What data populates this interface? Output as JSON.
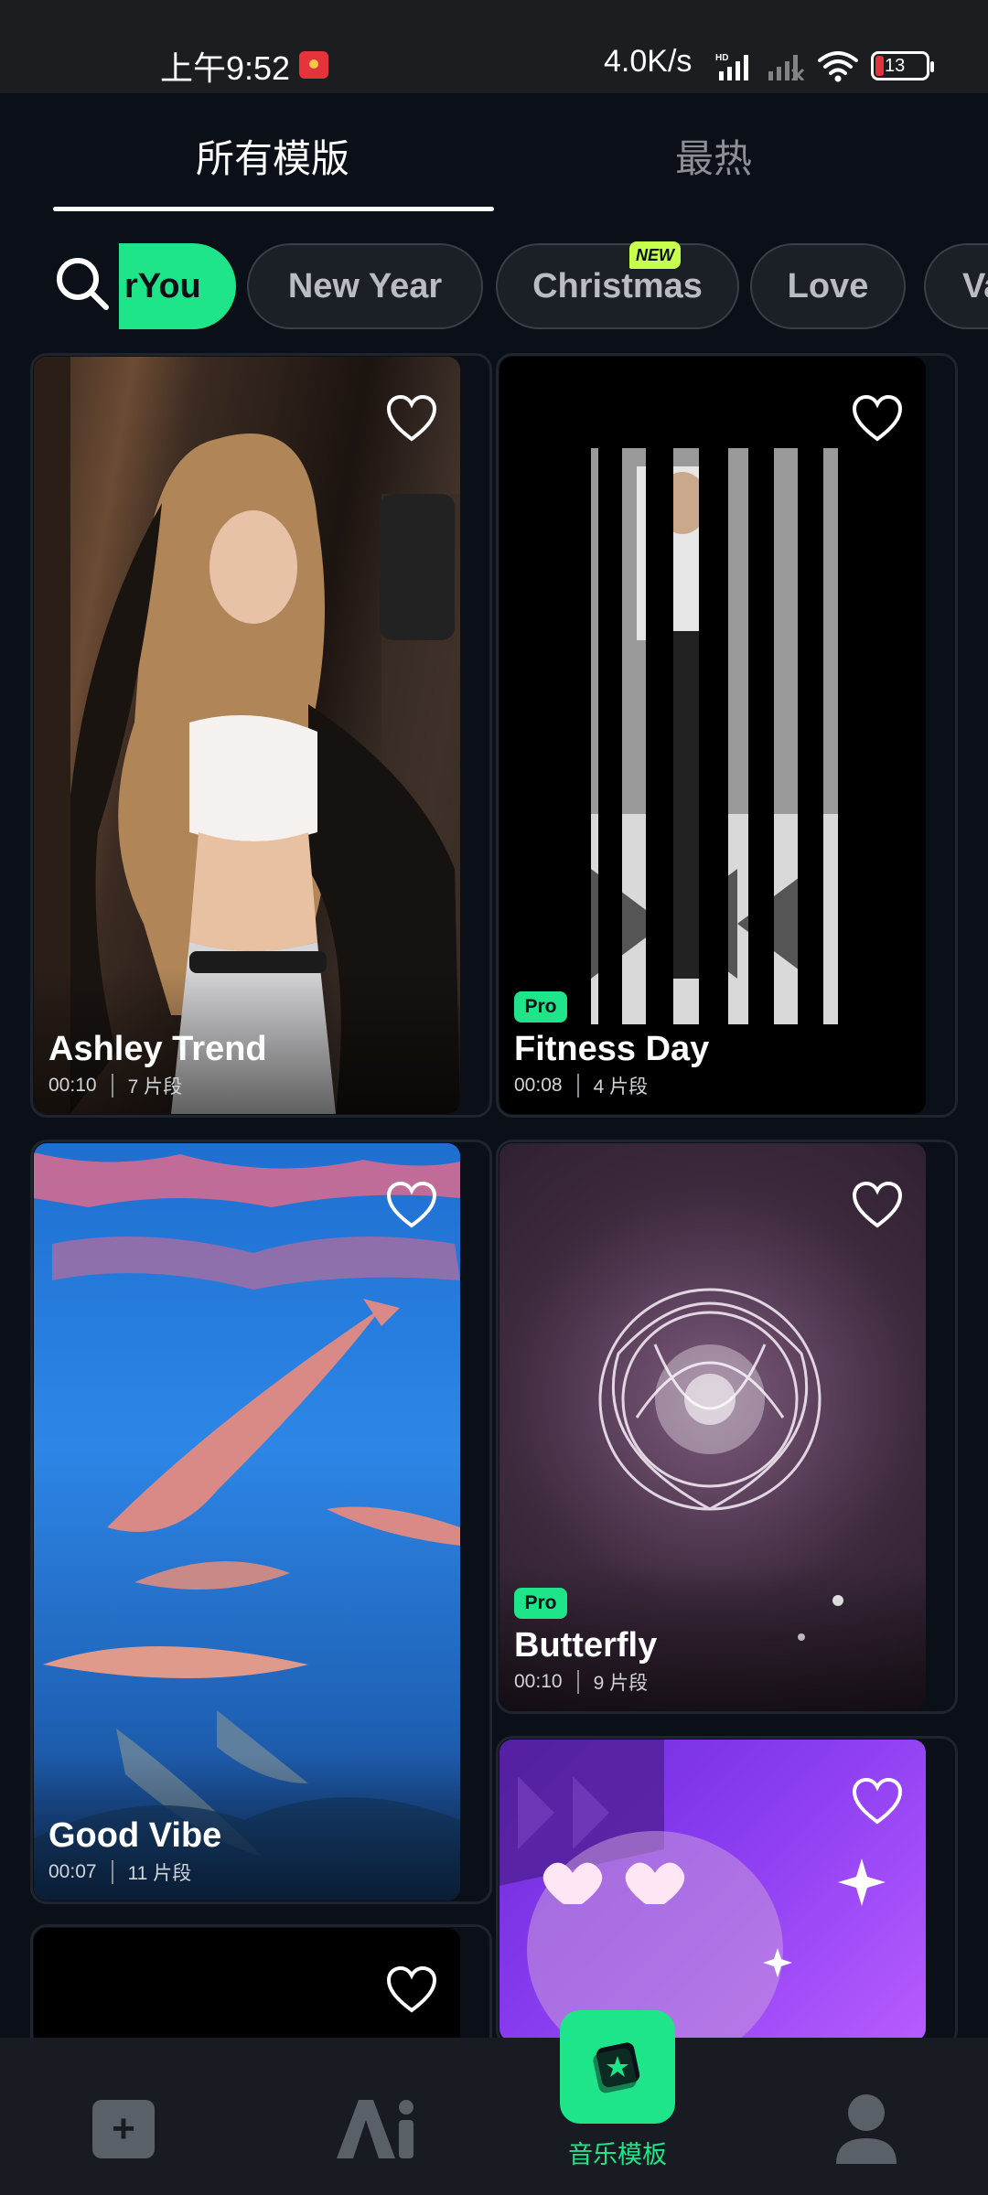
{
  "status_bar": {
    "time": "上午9:52",
    "network_speed": "4.0K/s",
    "battery": "13"
  },
  "tabs": [
    {
      "label": "所有模版",
      "active": true
    },
    {
      "label": "最热",
      "active": false
    }
  ],
  "categories": [
    {
      "label": "rYou",
      "active": true
    },
    {
      "label": "New Year",
      "active": false
    },
    {
      "label": "Christmas",
      "active": false
    },
    {
      "label": "Love",
      "active": false,
      "badge": "NEW"
    },
    {
      "label": "Va",
      "active": false
    }
  ],
  "cards": [
    {
      "title": "Ashley Trend",
      "duration": "00:10",
      "clips": "7 片段",
      "pro": false
    },
    {
      "title": "Fitness Day",
      "duration": "00:08",
      "clips": "4 片段",
      "pro": true,
      "pro_label": "Pro"
    },
    {
      "title": "Good Vibe",
      "duration": "00:07",
      "clips": "11 片段",
      "pro": false
    },
    {
      "title": "Butterfly",
      "duration": "00:10",
      "clips": "9 片段",
      "pro": true,
      "pro_label": "Pro"
    }
  ],
  "bottom_nav": {
    "add_label": "+",
    "music_label": "音乐模板"
  },
  "colors": {
    "accent": "#1fe58a",
    "background": "#0b0f17",
    "pro_badge": "#1fe58a",
    "new_badge": "#c6ff4d"
  }
}
